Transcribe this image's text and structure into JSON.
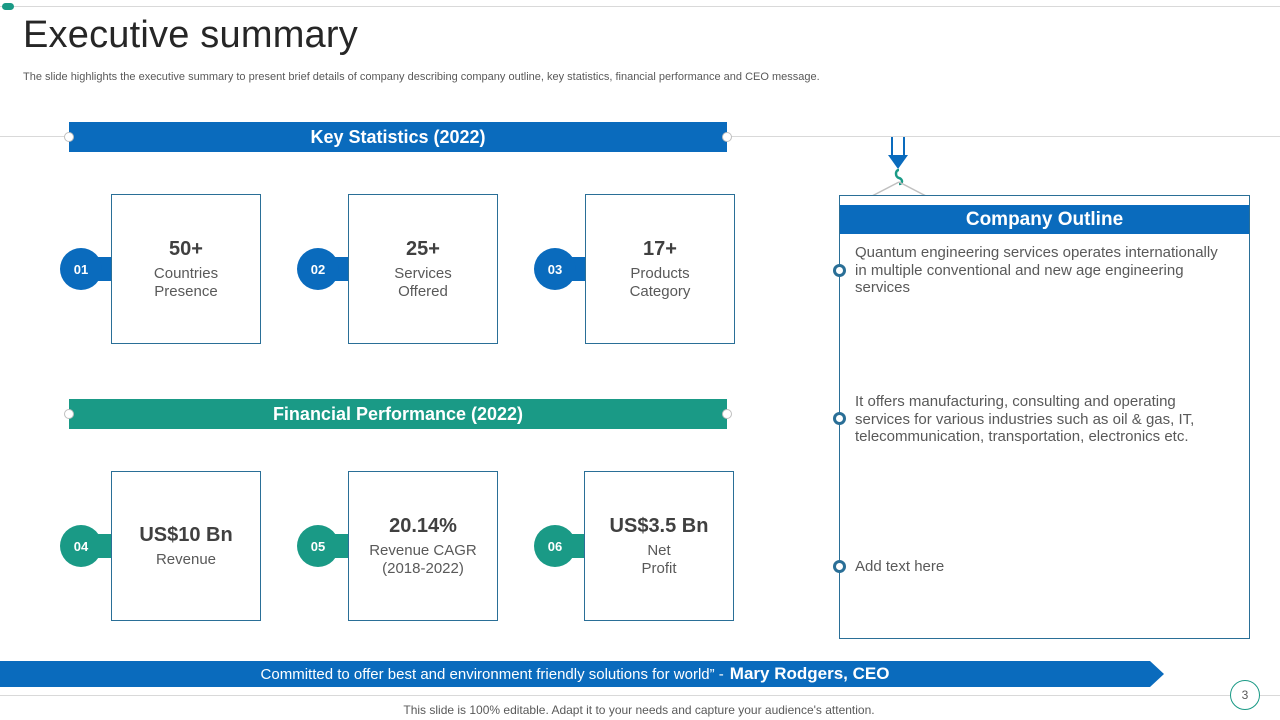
{
  "slide": {
    "title": "Executive summary",
    "subtitle": "The slide highlights the executive summary to present brief details of company describing company outline, key statistics, financial performance and CEO message.",
    "page_number": "3",
    "footer": "This slide is 100% editable. Adapt it to your needs and capture your audience's attention."
  },
  "key_statistics": {
    "header": "Key Statistics (2022)",
    "items": [
      {
        "num": "01",
        "value": "50+",
        "label": "Countries\nPresence"
      },
      {
        "num": "02",
        "value": "25+",
        "label": "Services\nOffered"
      },
      {
        "num": "03",
        "value": "17+",
        "label": "Products\nCategory"
      }
    ]
  },
  "financial_performance": {
    "header": "Financial Performance (2022)",
    "items": [
      {
        "num": "04",
        "value": "US$10 Bn",
        "label": "Revenue"
      },
      {
        "num": "05",
        "value": "20.14%",
        "label": "Revenue CAGR\n(2018-2022)"
      },
      {
        "num": "06",
        "value": "US$3.5 Bn",
        "label": "Net\nProfit"
      }
    ]
  },
  "company_outline": {
    "header": "Company Outline",
    "points": [
      "Quantum engineering services operates internationally in multiple conventional and new age engineering services",
      "It offers manufacturing, consulting and operating services for various industries such as oil & gas, IT, telecommunication, transportation, electronics etc.",
      "Add text here"
    ]
  },
  "quote": {
    "text": "Committed to offer best and environment friendly solutions for world”  -",
    "author": "Mary Rodgers, CEO"
  },
  "colors": {
    "blue": "#0a6bbd",
    "green": "#1a9a86",
    "outline_border": "#2a6f97"
  }
}
